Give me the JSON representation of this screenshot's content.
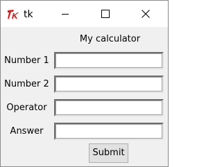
{
  "window": {
    "title": "tk",
    "app_icon": "tk-feather-icon",
    "controls": {
      "minimize": "minimize-icon",
      "maximize": "maximize-icon",
      "close": "close-icon"
    }
  },
  "form": {
    "heading": "My calculator",
    "fields": [
      {
        "label": "Number 1",
        "value": ""
      },
      {
        "label": "Number 2",
        "value": ""
      },
      {
        "label": "Operator",
        "value": ""
      },
      {
        "label": "Answer",
        "value": ""
      }
    ],
    "submit_label": "Submit"
  },
  "colors": {
    "window_background": "#f0f0f0",
    "titlebar_background": "#ffffff",
    "icon_red": "#cc1f1f",
    "button_background": "#e1e1e1"
  }
}
